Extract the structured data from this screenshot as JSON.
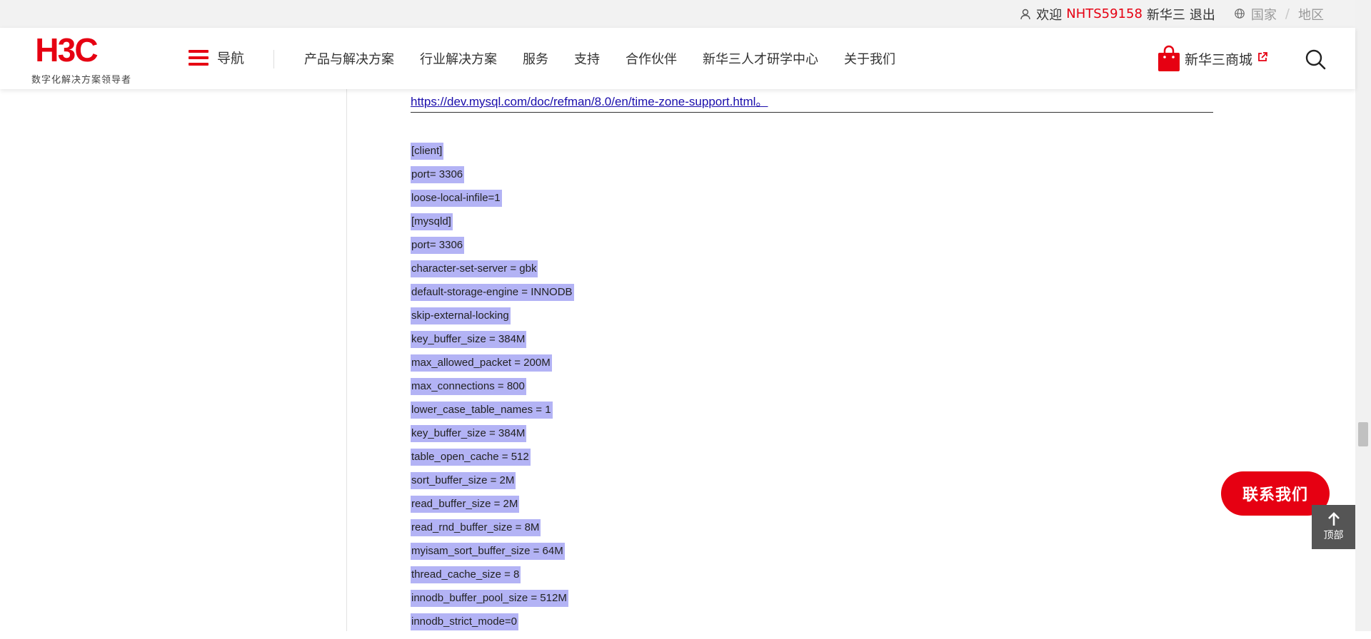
{
  "topbar": {
    "welcome": "欢迎",
    "username": "NHTS59158",
    "company": "新华三",
    "logout": "退出",
    "country": "国家",
    "separator": "/",
    "region": "地区",
    "icons": {
      "user": "user-icon",
      "globe": "globe-icon"
    }
  },
  "header": {
    "logo_text": "H3C",
    "slogan": "数字化解决方案领导者",
    "nav_label": "导航",
    "menu": [
      "产品与解决方案",
      "行业解决方案",
      "服务",
      "支持",
      "合作伙伴",
      "新华三人才研学中心",
      "关于我们"
    ],
    "shop_label": "新华三商城",
    "icons": {
      "shop": "shopping-bag-icon",
      "external": "external-link-icon",
      "search": "search-icon",
      "menu": "hamburger-icon"
    }
  },
  "content": {
    "link": "https://dev.mysql.com/doc/refman/8.0/en/time-zone-support.html",
    "link_suffix": "。",
    "config_lines": [
      "[client]",
      "port= 3306",
      "loose-local-infile=1",
      "[mysqld]",
      "port= 3306",
      "character-set-server = gbk",
      "default-storage-engine = INNODB",
      "skip-external-locking",
      "key_buffer_size = 384M",
      "max_allowed_packet = 200M",
      "max_connections = 800",
      "lower_case_table_names = 1",
      "key_buffer_size = 384M",
      "table_open_cache = 512",
      "sort_buffer_size = 2M",
      "read_buffer_size = 2M",
      "read_rnd_buffer_size = 8M",
      "myisam_sort_buffer_size = 64M",
      "thread_cache_size = 8",
      "innodb_buffer_pool_size = 512M",
      "innodb_strict_mode=0"
    ]
  },
  "floating": {
    "contact": "联系我们",
    "top": "顶部"
  },
  "colors": {
    "brand_red": "#e60012",
    "selection": "#b3b3f5",
    "link": "#1a0dab"
  }
}
